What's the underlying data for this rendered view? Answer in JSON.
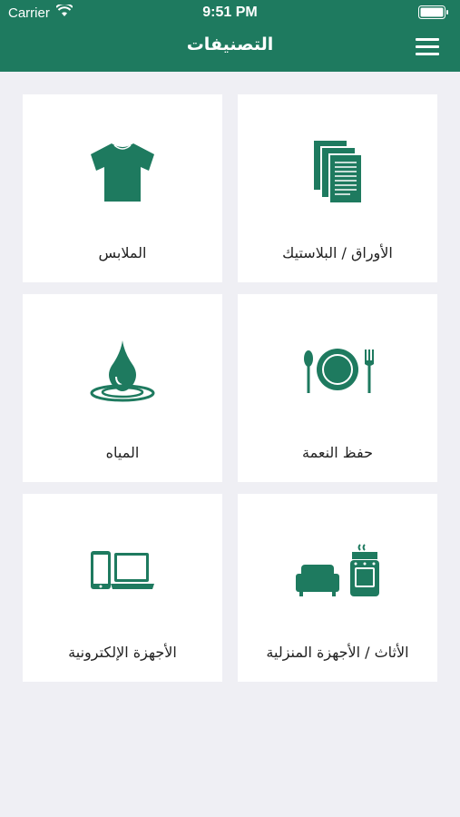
{
  "status_bar": {
    "carrier": "Carrier",
    "time": "9:51 PM"
  },
  "nav": {
    "title": "التصنيفات",
    "menu_icon": "hamburger-menu-icon"
  },
  "accent_color": "#1e7a5f",
  "categories": [
    {
      "label": "الأوراق / البلاستيك",
      "icon": "paper-documents-icon"
    },
    {
      "label": "الملابس",
      "icon": "tshirt-icon"
    },
    {
      "label": "حفظ النعمة",
      "icon": "plate-fork-spoon-icon"
    },
    {
      "label": "المياه",
      "icon": "water-drop-icon"
    },
    {
      "label": "الأثاث / الأجهزة المنزلية",
      "icon": "sofa-stove-icon"
    },
    {
      "label": "الأجهزة الإلكترونية",
      "icon": "phone-laptop-icon"
    }
  ]
}
